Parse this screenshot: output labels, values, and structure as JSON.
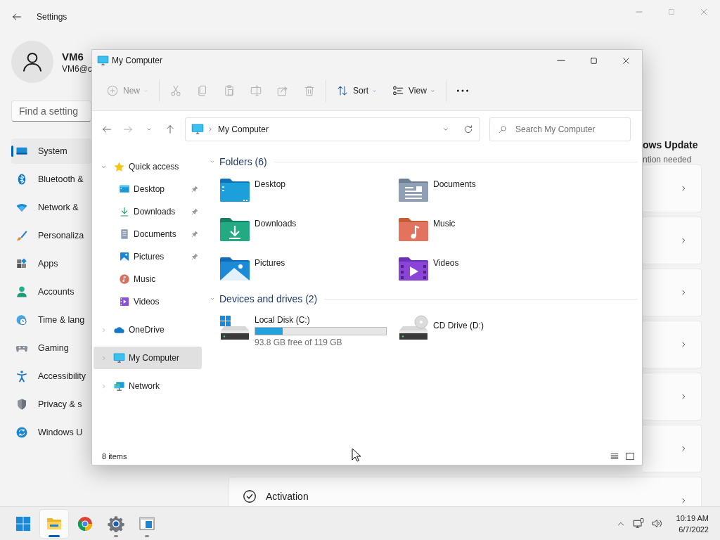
{
  "settings": {
    "title": "Settings",
    "user": {
      "name": "VM6",
      "email": "VM6@c"
    },
    "search": {
      "placeholder": "Find a setting"
    },
    "nav": [
      {
        "label": "System",
        "selected": true
      },
      {
        "label": "Bluetooth &",
        "selected": false
      },
      {
        "label": "Network &",
        "selected": false
      },
      {
        "label": "Personaliza",
        "selected": false
      },
      {
        "label": "Apps",
        "selected": false
      },
      {
        "label": "Accounts",
        "selected": false
      },
      {
        "label": "Time & lang",
        "selected": false
      },
      {
        "label": "Gaming",
        "selected": false
      },
      {
        "label": "Accessibility",
        "selected": false
      },
      {
        "label": "Privacy & s",
        "selected": false
      },
      {
        "label": "Windows U",
        "selected": false
      }
    ],
    "update": {
      "title": "ows Update",
      "subtitle": "ntion needed"
    },
    "cards": [
      {
        "kind": "plain"
      },
      {
        "kind": "plain"
      },
      {
        "kind": "plain"
      },
      {
        "kind": "plain"
      },
      {
        "kind": "plain"
      },
      {
        "kind": "plain"
      },
      {
        "kind": "titled",
        "title": "Activation"
      }
    ]
  },
  "explorer": {
    "title": "My Computer",
    "toolbar": [
      {
        "kind": "new",
        "label": "New",
        "disabled": true
      },
      {
        "kind": "cut",
        "disabled": true
      },
      {
        "kind": "copy",
        "disabled": true
      },
      {
        "kind": "paste",
        "disabled": true
      },
      {
        "kind": "rename",
        "disabled": true
      },
      {
        "kind": "share",
        "disabled": true
      },
      {
        "kind": "delete",
        "disabled": true
      },
      {
        "kind": "sort",
        "label": "Sort",
        "disabled": false
      },
      {
        "kind": "view",
        "label": "View",
        "disabled": false
      },
      {
        "kind": "more",
        "disabled": false
      }
    ],
    "address": {
      "path": "My Computer"
    },
    "search": {
      "placeholder": "Search My Computer"
    },
    "tree": [
      {
        "label": "Quick access",
        "expanded": true,
        "selected": false,
        "children": [
          {
            "label": "Desktop",
            "pinned": true
          },
          {
            "label": "Downloads",
            "pinned": true
          },
          {
            "label": "Documents",
            "pinned": true
          },
          {
            "label": "Pictures",
            "pinned": true
          },
          {
            "label": "Music",
            "pinned": false
          },
          {
            "label": "Videos",
            "pinned": false
          }
        ]
      },
      {
        "label": "OneDrive",
        "expanded": false,
        "selected": false
      },
      {
        "label": "My Computer",
        "expanded": false,
        "selected": true
      },
      {
        "label": "Network",
        "expanded": false,
        "selected": false
      }
    ],
    "sections": [
      {
        "title": "Folders (6)",
        "expanded": true,
        "items": [
          {
            "kind": "folder",
            "label": "Desktop"
          },
          {
            "kind": "folder",
            "label": "Documents"
          },
          {
            "kind": "folder",
            "label": "Downloads"
          },
          {
            "kind": "folder",
            "label": "Music"
          },
          {
            "kind": "folder",
            "label": "Pictures"
          },
          {
            "kind": "folder",
            "label": "Videos"
          }
        ]
      },
      {
        "title": "Devices and drives (2)",
        "expanded": true,
        "items": [
          {
            "kind": "disk",
            "label": "Local Disk (C:)",
            "level": 0.21,
            "detail": "93.8 GB free of 119 GB"
          },
          {
            "kind": "optical",
            "label": "CD Drive (D:)"
          }
        ]
      }
    ],
    "status": {
      "count": "8 items"
    }
  },
  "taskbar": {
    "apps": [
      {
        "active": true,
        "running": true
      },
      {
        "active": false,
        "running": false
      },
      {
        "active": false,
        "running": true
      },
      {
        "active": false,
        "running": true
      }
    ],
    "clock": {
      "time": "10:19 AM",
      "date": "6/7/2022"
    }
  }
}
